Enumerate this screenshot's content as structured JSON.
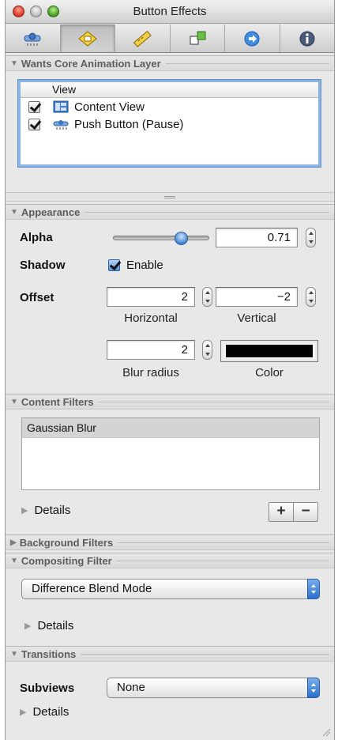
{
  "window": {
    "title": "Button Effects"
  },
  "toolbar": {
    "tabs": [
      {
        "icon": "attributes-inspector-icon"
      },
      {
        "icon": "effects-inspector-icon"
      },
      {
        "icon": "size-inspector-icon"
      },
      {
        "icon": "connections-inspector-icon"
      },
      {
        "icon": "bindings-inspector-icon"
      },
      {
        "icon": "identity-inspector-icon"
      }
    ],
    "active_index": 1
  },
  "layer_section": {
    "title": "Wants Core Animation Layer",
    "column_header": "View",
    "rows": [
      {
        "label": "Content View",
        "checked": true
      },
      {
        "label": "Push Button (Pause)",
        "checked": true
      }
    ]
  },
  "appearance": {
    "title": "Appearance",
    "alpha_label": "Alpha",
    "alpha_value": "0.71",
    "alpha_fraction": 0.71,
    "shadow_label": "Shadow",
    "enable_label": "Enable",
    "offset_label": "Offset",
    "horizontal_value": "2",
    "vertical_value": "−2",
    "horizontal_label": "Horizontal",
    "vertical_label": "Vertical",
    "blur_value": "2",
    "blur_label": "Blur radius",
    "color_label": "Color",
    "shadow_color": "#000000"
  },
  "content_filters": {
    "title": "Content Filters",
    "items": [
      "Gaussian Blur"
    ],
    "details_label": "Details",
    "add_label": "+",
    "remove_label": "−"
  },
  "background_filters": {
    "title": "Background Filters"
  },
  "compositing": {
    "title": "Compositing Filter",
    "selected": "Difference Blend Mode",
    "details_label": "Details"
  },
  "transitions": {
    "title": "Transitions",
    "subviews_label": "Subviews",
    "selected": "None",
    "details_label": "Details"
  }
}
